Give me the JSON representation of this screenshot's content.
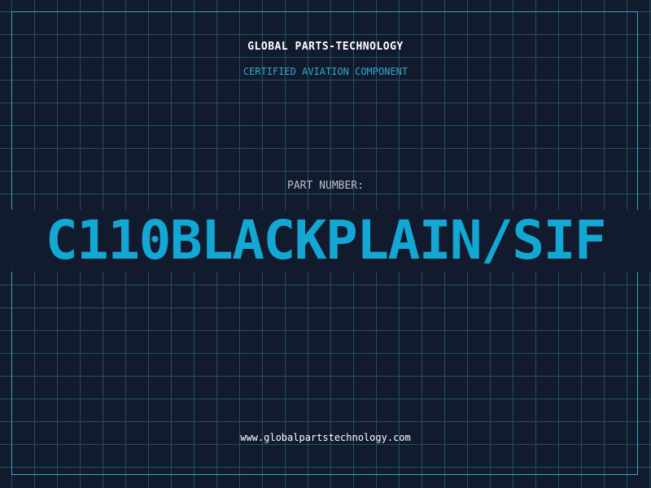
{
  "header": {
    "company": "GLOBAL PARTS-TECHNOLOGY",
    "tagline": "CERTIFIED AVIATION COMPONENT"
  },
  "part": {
    "label": "PART NUMBER:",
    "number": "C110BLACKPLAIN/SIF"
  },
  "footer": {
    "url": "www.globalpartstechnology.com"
  },
  "colors": {
    "background": "#121a2e",
    "grid": "#1e5360",
    "accent": "#13a8d4",
    "text": "#ffffff"
  }
}
